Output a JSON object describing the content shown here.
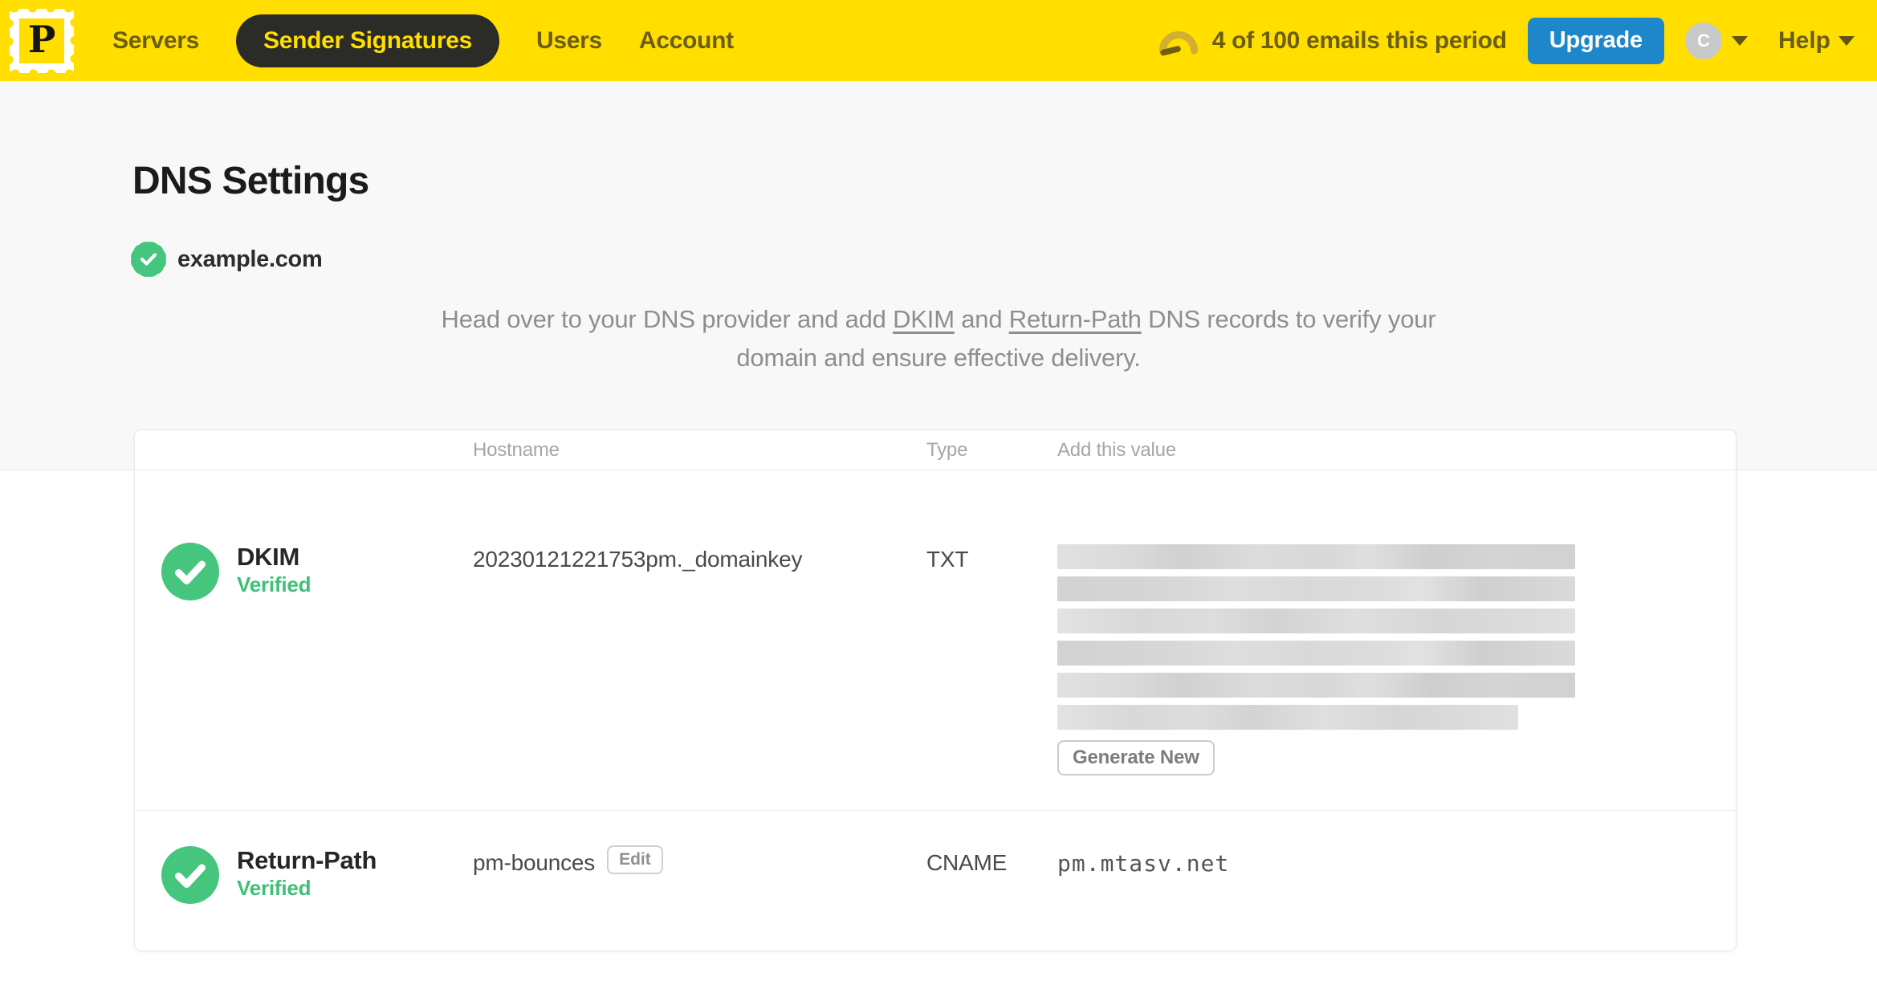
{
  "colors": {
    "brand_yellow": "#FFDE00",
    "nav_text_olive": "#6B5E11",
    "active_pill_bg": "#2B2B28",
    "upgrade_blue": "#1E87CB",
    "verified_green": "#45C57D",
    "page_band_gray": "#F8F8F8"
  },
  "nav": {
    "logo_letter": "P",
    "items": [
      {
        "label": "Servers",
        "active": false
      },
      {
        "label": "Sender Signatures",
        "active": true
      },
      {
        "label": "Users",
        "active": false
      },
      {
        "label": "Account",
        "active": false
      }
    ],
    "usage_text": "4 of 100 emails this period",
    "upgrade_label": "Upgrade",
    "avatar_initial": "C",
    "help_label": "Help"
  },
  "page": {
    "title": "DNS Settings",
    "domain": "example.com",
    "intro": {
      "part1": "Head over to your DNS provider and add ",
      "link1": "DKIM",
      "part2": " and ",
      "link2": "Return-Path",
      "part3": " DNS records to verify your domain and ensure effective delivery."
    }
  },
  "table": {
    "headers": {
      "hostname": "Hostname",
      "type": "Type",
      "value": "Add this value"
    },
    "rows": [
      {
        "name": "DKIM",
        "status": "Verified",
        "hostname": "20230121221753pm._domainkey",
        "type": "TXT",
        "value_redacted": true,
        "action_label": "Generate New"
      },
      {
        "name": "Return-Path",
        "status": "Verified",
        "hostname": "pm-bounces",
        "edit_label": "Edit",
        "type": "CNAME",
        "value": "pm.mtasv.net"
      }
    ]
  }
}
